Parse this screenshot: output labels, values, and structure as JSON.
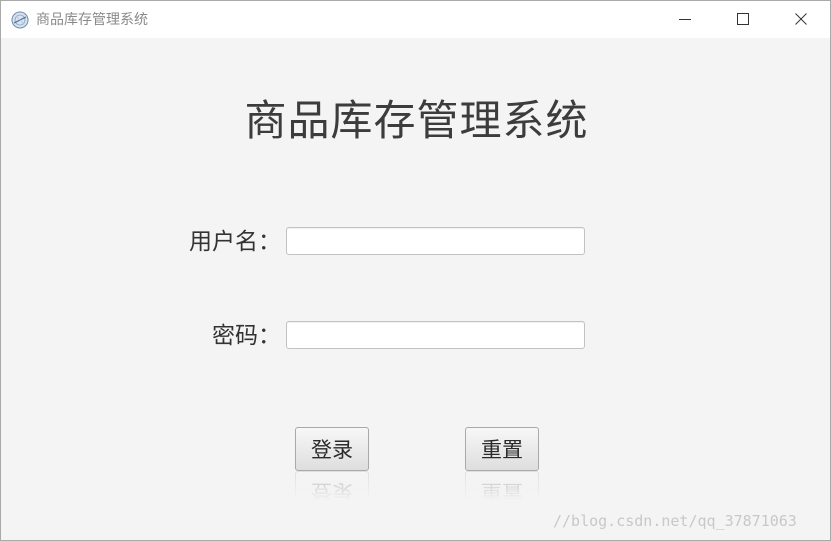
{
  "window": {
    "title": "商品库存管理系统",
    "controls": {
      "minimize_icon": "minimize-icon",
      "maximize_icon": "maximize-icon",
      "close_icon": "close-icon"
    }
  },
  "main": {
    "heading": "商品库存管理系统",
    "form": {
      "username_label": "用户名：",
      "username_value": "",
      "password_label": "密码：",
      "password_value": ""
    },
    "buttons": {
      "login_label": "登录",
      "reset_label": "重置"
    }
  },
  "watermark": "//blog.csdn.net/qq_37871063",
  "colors": {
    "titlebar_bg": "#ffffff",
    "content_bg": "#f4f4f4",
    "heading_text": "#3c3c3c",
    "button_border": "#a9a9a9"
  }
}
